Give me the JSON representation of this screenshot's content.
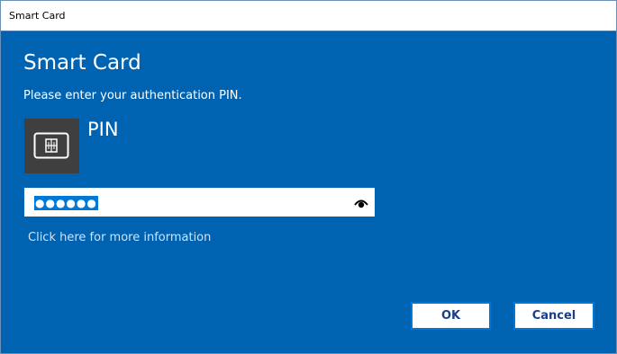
{
  "window": {
    "title": "Smart Card",
    "accent_color": "#0063b1"
  },
  "dialog": {
    "heading": "Smart Card",
    "subtitle": "Please enter your authentication PIN.",
    "credential_icon": "smart-card-icon",
    "credential_label": "PIN",
    "pin_field": {
      "value_masked": "●●●●●●",
      "reveal_icon": "eye-icon"
    },
    "more_info_link": "Click here for more information",
    "buttons": {
      "ok": "OK",
      "cancel": "Cancel"
    }
  }
}
